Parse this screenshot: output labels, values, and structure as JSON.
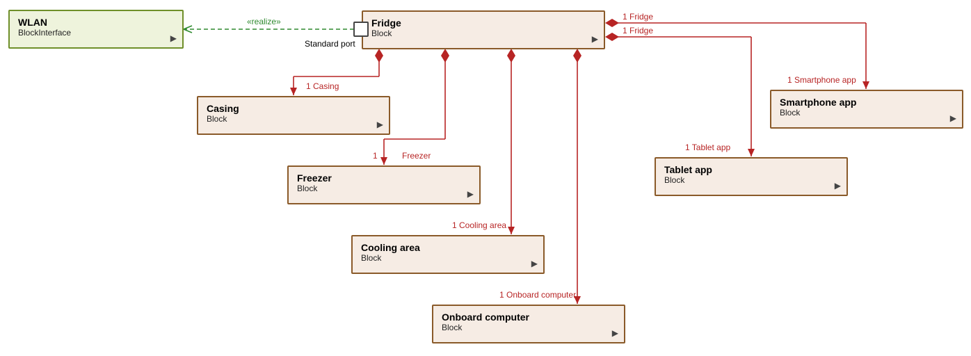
{
  "chart_data": {
    "type": "diagram",
    "diagram_kind": "SysML Block Definition Diagram",
    "blocks": [
      {
        "id": "wlan",
        "name": "WLAN",
        "stereotype": "BlockInterface",
        "kind": "interface"
      },
      {
        "id": "fridge",
        "name": "Fridge",
        "stereotype": "Block",
        "kind": "block",
        "ports": [
          {
            "id": "std_port",
            "name": "Standard port"
          }
        ]
      },
      {
        "id": "casing",
        "name": "Casing",
        "stereotype": "Block",
        "kind": "block"
      },
      {
        "id": "freezer",
        "name": "Freezer",
        "stereotype": "Block",
        "kind": "block"
      },
      {
        "id": "cooling",
        "name": "Cooling area",
        "stereotype": "Block",
        "kind": "block"
      },
      {
        "id": "onboard",
        "name": "Onboard computer",
        "stereotype": "Block",
        "kind": "block"
      },
      {
        "id": "tablet",
        "name": "Tablet app",
        "stereotype": "Block",
        "kind": "block"
      },
      {
        "id": "smartphone",
        "name": "Smartphone app",
        "stereotype": "Block",
        "kind": "block"
      }
    ],
    "relationships": [
      {
        "type": "realize",
        "from": "fridge.std_port",
        "to": "wlan",
        "label": "«realize»"
      },
      {
        "type": "composition",
        "whole": "fridge",
        "part": "casing",
        "whole_mult": "",
        "part_mult": "1",
        "part_role": "Casing"
      },
      {
        "type": "composition",
        "whole": "fridge",
        "part": "freezer",
        "whole_mult": "",
        "part_mult": "1",
        "part_role": "Freezer"
      },
      {
        "type": "composition",
        "whole": "fridge",
        "part": "cooling",
        "whole_mult": "",
        "part_mult": "1",
        "part_role": "Cooling area"
      },
      {
        "type": "composition",
        "whole": "fridge",
        "part": "onboard",
        "whole_mult": "",
        "part_mult": "1",
        "part_role": "Onboard computer"
      },
      {
        "type": "composition",
        "whole": "fridge",
        "part": "tablet",
        "whole_mult": "1",
        "whole_role": "Fridge",
        "part_mult": "1",
        "part_role": "Tablet app"
      },
      {
        "type": "composition",
        "whole": "fridge",
        "part": "smartphone",
        "whole_mult": "1",
        "whole_role": "Fridge",
        "part_mult": "1",
        "part_role": "Smartphone app"
      }
    ]
  },
  "blocks": {
    "wlan": {
      "title": "WLAN",
      "subtitle": "BlockInterface"
    },
    "fridge": {
      "title": "Fridge",
      "subtitle": "Block"
    },
    "casing": {
      "title": "Casing",
      "subtitle": "Block"
    },
    "freezer": {
      "title": "Freezer",
      "subtitle": "Block"
    },
    "cooling": {
      "title": "Cooling area",
      "subtitle": "Block"
    },
    "onboard": {
      "title": "Onboard computer",
      "subtitle": "Block"
    },
    "tablet": {
      "title": "Tablet app",
      "subtitle": "Block"
    },
    "smartphone": {
      "title": "Smartphone app",
      "subtitle": "Block"
    }
  },
  "labels": {
    "realize": "«realize»",
    "std_port": "Standard port",
    "casing_end": "1 Casing",
    "freezer_mult": "1",
    "freezer_role": "Freezer",
    "cooling_end": "1 Cooling area",
    "onboard_end": "1 Onboard computer",
    "tablet_end": "1 Tablet app",
    "smartphone_end": "1 Smartphone app",
    "fridge_end_top": "1 Fridge",
    "fridge_end_bot": "1 Fridge"
  },
  "glyph": "▶"
}
